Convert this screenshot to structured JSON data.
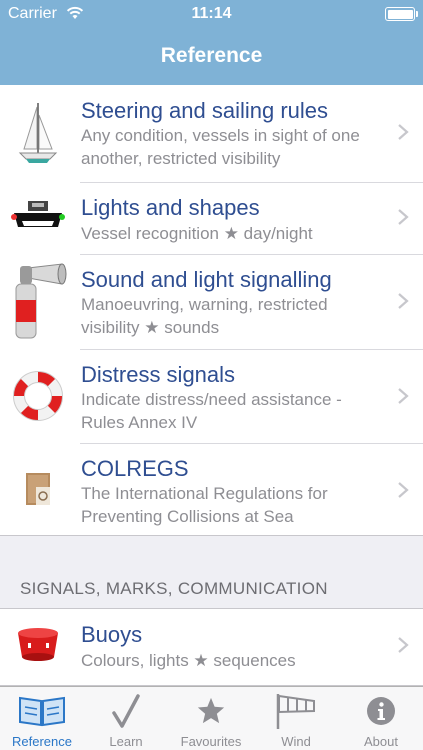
{
  "status_bar": {
    "carrier": "Carrier",
    "time": "11:14"
  },
  "nav": {
    "title": "Reference"
  },
  "rows": [
    {
      "title": "Steering and sailing rules",
      "subtitle": "Any condition, vessels in sight of one another, restricted visibility",
      "icon": "sailboat-icon"
    },
    {
      "title": "Lights and shapes",
      "subtitle": "Vessel recognition ★ day/night",
      "icon": "vessel-lights-icon"
    },
    {
      "title": "Sound and light signalling",
      "subtitle": "Manoeuvring, warning, restricted visibility ★ sounds",
      "icon": "air-horn-icon"
    },
    {
      "title": "Distress signals",
      "subtitle": "Indicate distress/need assistance - Rules Annex IV",
      "icon": "lifebuoy-icon"
    },
    {
      "title": "COLREGS",
      "subtitle": "The International Regulations for Preventing Collisions at Sea",
      "icon": "colregs-book-icon"
    }
  ],
  "section_header": "SIGNALS, MARKS, COMMUNICATION",
  "section_rows": [
    {
      "title": "Buoys",
      "subtitle": "Colours, lights ★ sequences",
      "icon": "buoy-icon"
    }
  ],
  "tabs": [
    {
      "label": "Reference",
      "icon": "book-icon",
      "active": true
    },
    {
      "label": "Learn",
      "icon": "checkmark-icon",
      "active": false
    },
    {
      "label": "Favourites",
      "icon": "star-icon",
      "active": false
    },
    {
      "label": "Wind",
      "icon": "windsock-icon",
      "active": false
    },
    {
      "label": "About",
      "icon": "info-icon",
      "active": false
    }
  ],
  "colors": {
    "nav_bar": "#7fb2d6",
    "title_text": "#2f4e91",
    "subtitle_text": "#8e8e93",
    "tab_active": "#2b77c7"
  }
}
